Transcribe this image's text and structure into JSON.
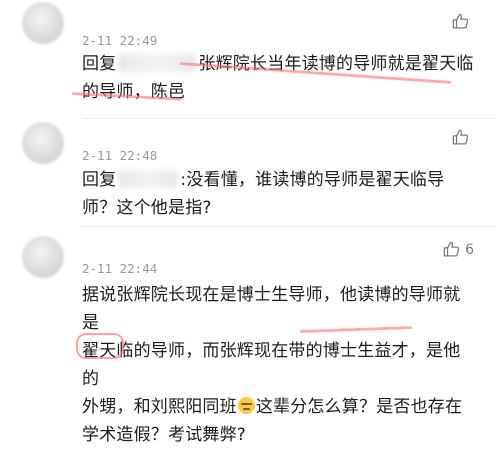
{
  "comments": [
    {
      "time": "2-11 22:49",
      "like_count": "",
      "text_prefix": "回复",
      "line1_rest": "张辉院长当年读博的导师就是翟天临",
      "line2": "的导师，陈邑"
    },
    {
      "time": "2-11 22:48",
      "like_count": "",
      "text_prefix": "回复",
      "line1_rest": ":没看懂，谁读博的导师是翟天临导",
      "line2": "师？这个他是指?"
    },
    {
      "time": "2-11 22:44",
      "like_count": "6",
      "line1": "据说张辉院长现在是博士生导师，他读博的导师就是",
      "line2": "翟天临的导师，而张辉现在带的博士生益才，是他的",
      "line3_pre": "外甥，和刘熙阳同班",
      "line3_post": "这辈分怎么算？是否也存在",
      "line4": "学术造假？考试舞弊?"
    }
  ],
  "icons": {
    "like": "thumbs-up-icon",
    "emoji": "smirk-face-emoji-icon"
  },
  "colors": {
    "highlight": "#ff6e78",
    "time": "#9a9a9a",
    "divider": "#ececec"
  }
}
